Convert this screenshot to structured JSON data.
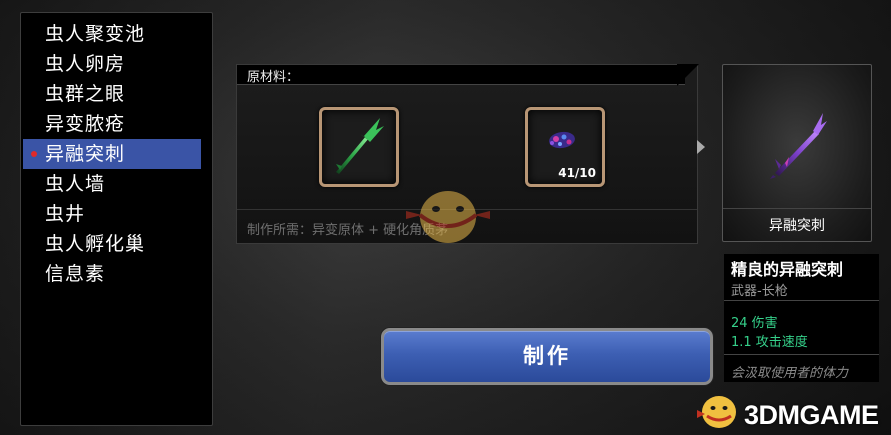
{
  "menu": {
    "items": [
      {
        "label": "虫人聚变池"
      },
      {
        "label": "虫人卵房"
      },
      {
        "label": "虫群之眼"
      },
      {
        "label": "异变脓疮"
      },
      {
        "label": "异融突刺"
      },
      {
        "label": "虫人墙"
      },
      {
        "label": "虫井"
      },
      {
        "label": "虫人孵化巢"
      },
      {
        "label": "信息素"
      }
    ],
    "selected_index": 4
  },
  "materials": {
    "title": "原材料：",
    "slots": [
      {
        "icon": "green-spear-icon",
        "count": ""
      },
      {
        "icon": "purple-carapace-icon",
        "count": "41/10"
      }
    ],
    "requirement": "制作所需：异变原体 + 硬化角质茅"
  },
  "result": {
    "label": "异融突刺",
    "icon": "purple-spear-icon"
  },
  "item_info": {
    "name": "精良的异融突刺",
    "type": "武器-长枪",
    "stats": [
      "24 伤害",
      "1.1 攻击速度"
    ],
    "description": "会汲取使用者的体力"
  },
  "craft_button": {
    "label": "制作"
  },
  "watermark": {
    "text": "3DMGAME"
  },
  "colors": {
    "selected_bg": "#3a54a6",
    "slot_border": "#b89675",
    "stat_green": "#35d08a",
    "button_blue": "#3d5fb3"
  }
}
